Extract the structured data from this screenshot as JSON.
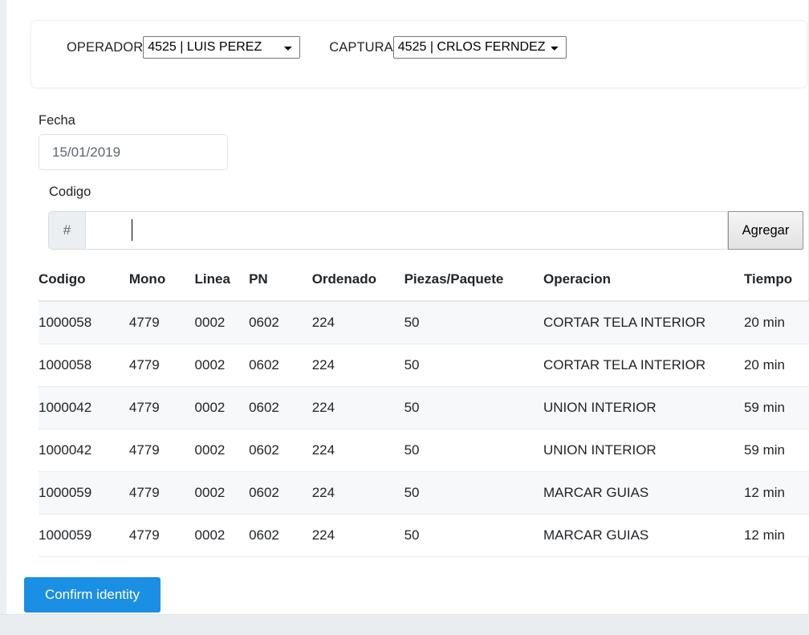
{
  "operator_card": {
    "operator": {
      "label": "OPERADOR",
      "value": "4525 | LUIS PEREZ",
      "options": [
        "4525 | LUIS PEREZ"
      ]
    },
    "captura": {
      "label": "CAPTURA",
      "value": "4525 | CRLOS FERNDEZ",
      "options": [
        "4525 | CRLOS FERNDEZ"
      ]
    }
  },
  "fecha": {
    "label": "Fecha",
    "value": "15/01/2019",
    "placeholder": "15/01/2019"
  },
  "codigo": {
    "label": "Codigo",
    "addon": "#",
    "value": "",
    "placeholder": "",
    "button_label": "Agregar"
  },
  "table": {
    "columns": [
      "Codigo",
      "Mono",
      "Linea",
      "PN",
      "Ordenado",
      "Piezas/Paquete",
      "Operacion",
      "Tiempo"
    ],
    "rows": [
      [
        "1000058",
        "4779",
        "0002",
        "0602",
        "224",
        "50",
        "CORTAR TELA INTERIOR",
        "20 min"
      ],
      [
        "1000058",
        "4779",
        "0002",
        "0602",
        "224",
        "50",
        "CORTAR TELA INTERIOR",
        "20 min"
      ],
      [
        "1000042",
        "4779",
        "0002",
        "0602",
        "224",
        "50",
        "UNION INTERIOR",
        "59 min"
      ],
      [
        "1000042",
        "4779",
        "0002",
        "0602",
        "224",
        "50",
        "UNION INTERIOR",
        "59 min"
      ],
      [
        "1000059",
        "4779",
        "0002",
        "0602",
        "224",
        "50",
        "MARCAR GUIAS",
        "12 min"
      ],
      [
        "1000059",
        "4779",
        "0002",
        "0602",
        "224",
        "50",
        "MARCAR GUIAS",
        "12 min"
      ]
    ]
  },
  "footer": {
    "confirm_label": "Confirm identity"
  },
  "colors": {
    "primary": "#1b8fe3",
    "row_stripe": "#f6f8f9",
    "addon_bg": "#eceff1",
    "footer_band": "#e9edf0"
  }
}
